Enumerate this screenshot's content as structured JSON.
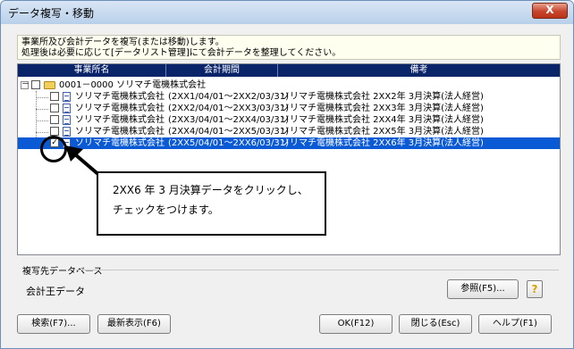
{
  "window": {
    "title": "データ複写・移動",
    "close_label": "X"
  },
  "message": {
    "line1": "事業所及び会計データを複写(または移動)します。",
    "line2": "処理後は必要に応じて[データリスト管理]にて会計データを整理してください。"
  },
  "tree": {
    "headers": [
      "事業所名",
      "会計期間",
      "備考"
    ],
    "root": {
      "expander": "－",
      "label": "0001－0000 ソリマチ電機株式会社"
    },
    "items": [
      {
        "name": "ソリマチ電機株式会社",
        "period": "(2XX1/04/01～2XX2/03/31)",
        "note": "ソリマチ電機株式会社 2XX2年 3月決算(法人経営)",
        "checked": ""
      },
      {
        "name": "ソリマチ電機株式会社",
        "period": "(2XX2/04/01～2XX3/03/31)",
        "note": "ソリマチ電機株式会社 2XX3年 3月決算(法人経営)",
        "checked": ""
      },
      {
        "name": "ソリマチ電機株式会社",
        "period": "(2XX3/04/01～2XX4/03/31)",
        "note": "ソリマチ電機株式会社 2XX4年 3月決算(法人経営)",
        "checked": ""
      },
      {
        "name": "ソリマチ電機株式会社",
        "period": "(2XX4/04/01～2XX5/03/31)",
        "note": "ソリマチ電機株式会社 2XX5年 3月決算(法人経営)",
        "checked": ""
      },
      {
        "name": "ソリマチ電機株式会社",
        "period": "(2XX5/04/01～2XX6/03/31)",
        "note": "ソリマチ電機株式会社 2XX6年 3月決算(法人経営)",
        "checked": "✓"
      }
    ]
  },
  "callout": {
    "line1": "2XX6 年 3 月決算データをクリックし、",
    "line2": "チェックをつけます。"
  },
  "destination": {
    "label": "複写先データベース",
    "value": "会計王データ",
    "browse_label": "参照(F5)...",
    "help_icon": "?"
  },
  "buttons": {
    "search": "検索(F7)...",
    "refresh": "最新表示(F6)",
    "ok": "OK(F12)",
    "close": "閉じる(Esc)",
    "help": "ヘルプ(F1)"
  }
}
